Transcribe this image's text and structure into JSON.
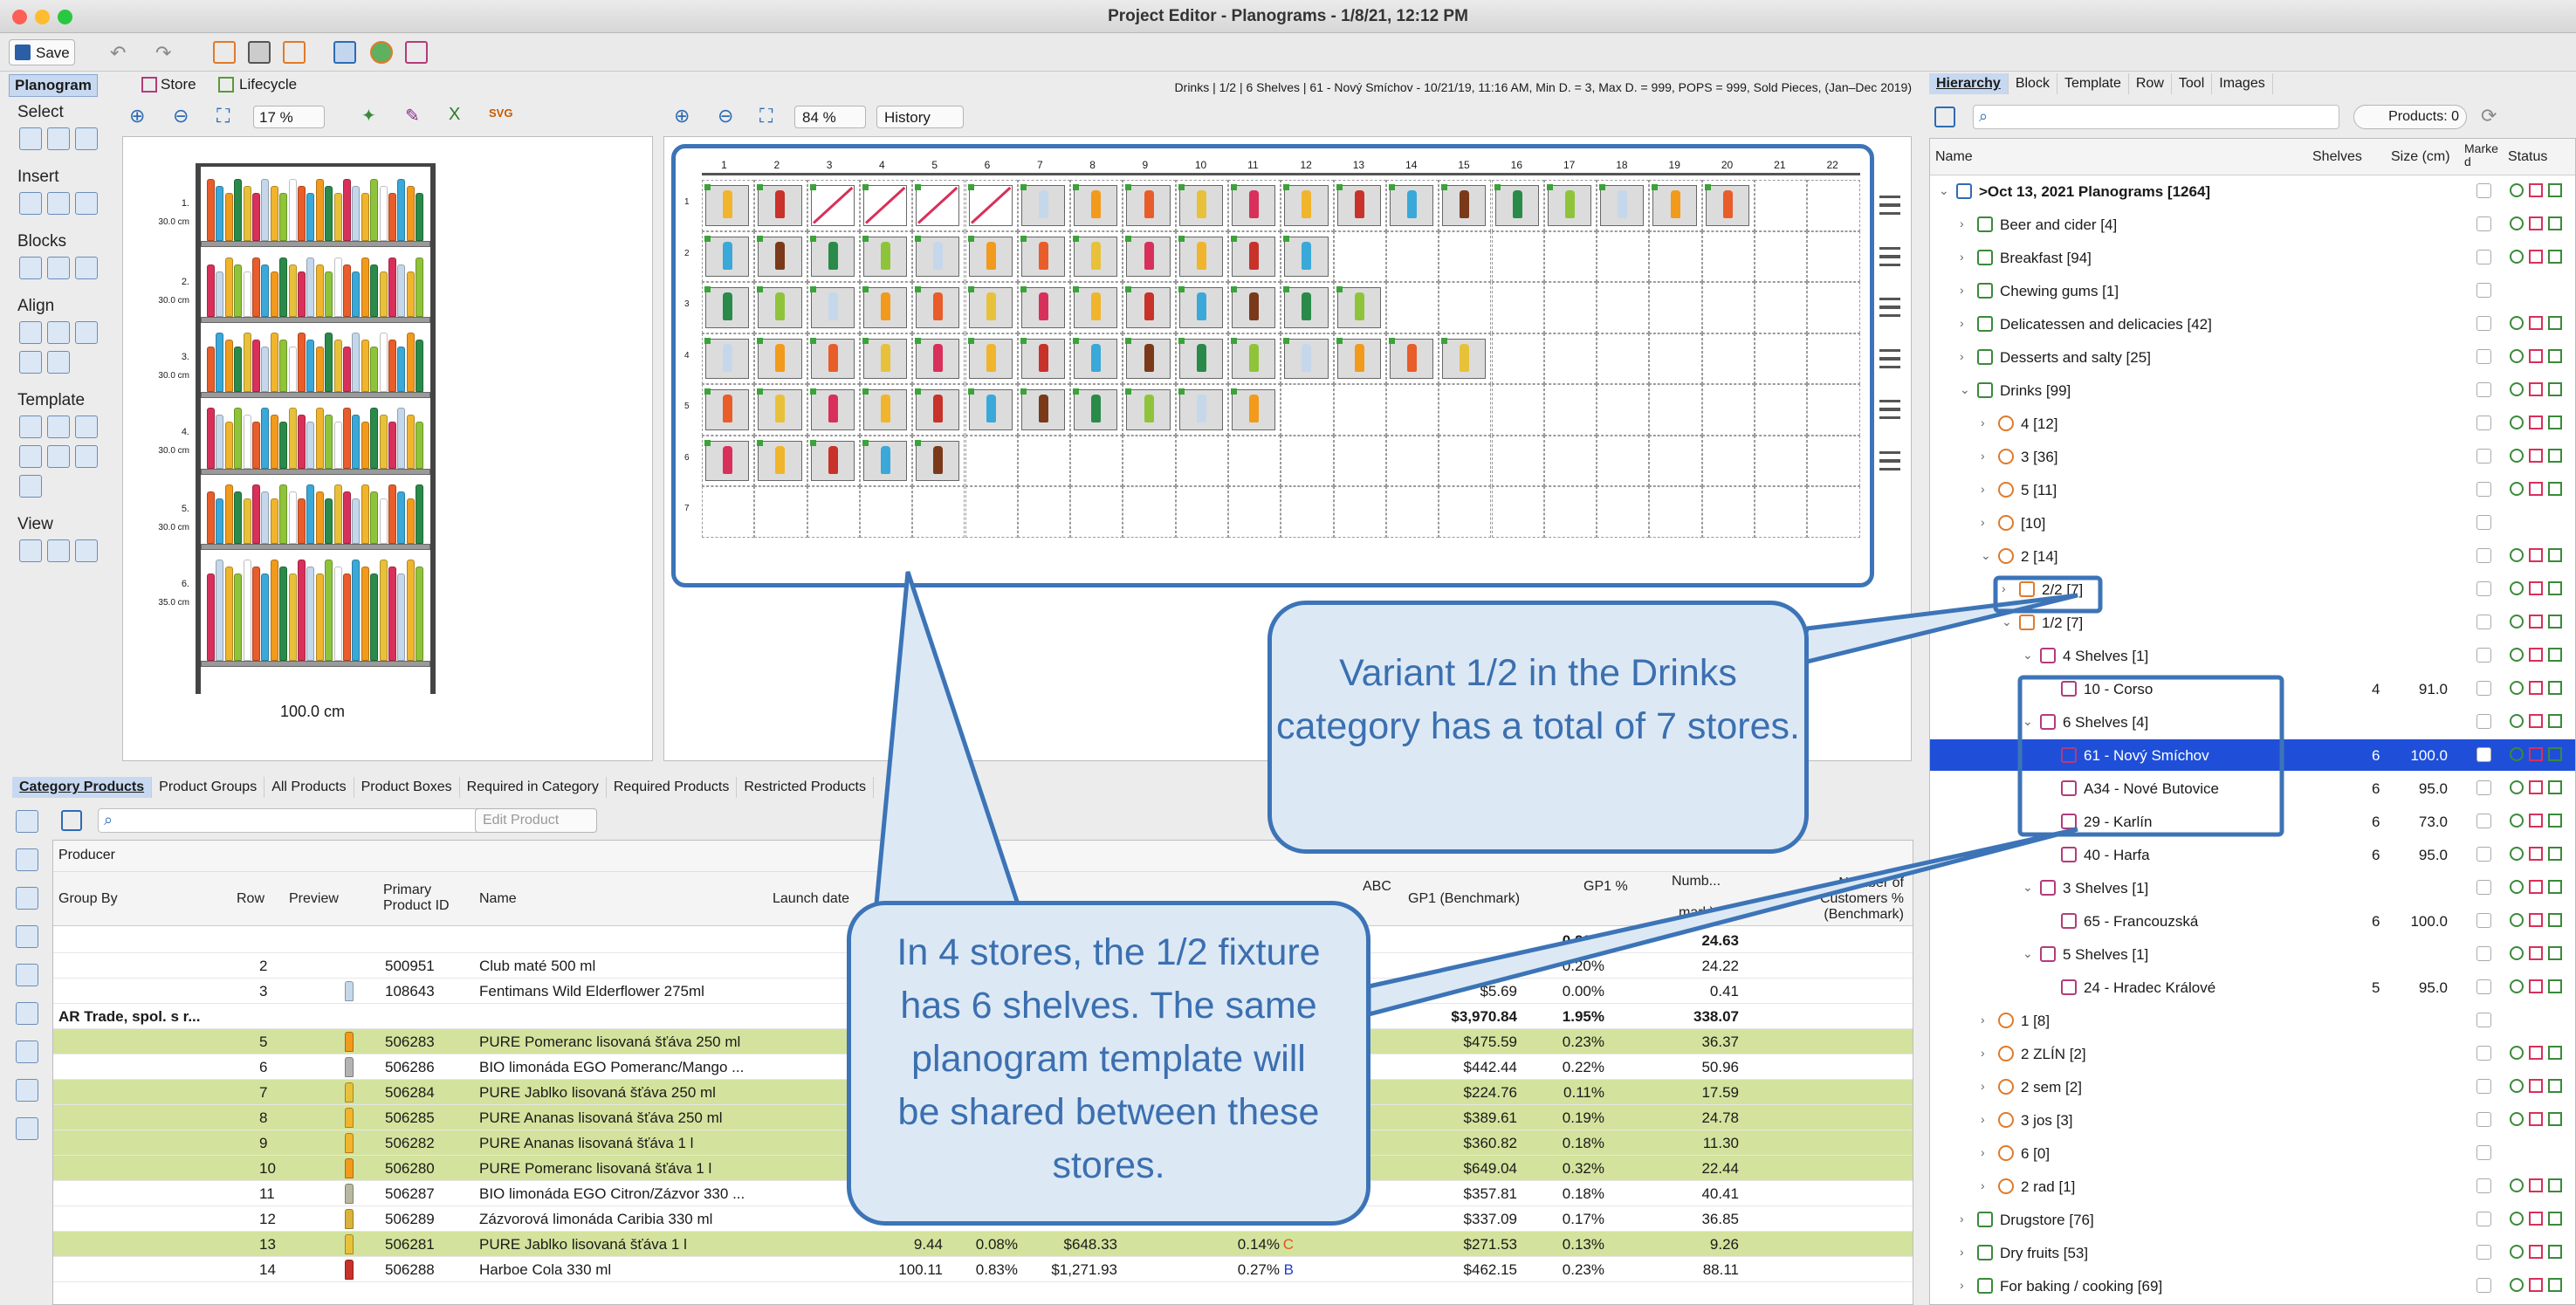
{
  "window": {
    "title": "Project Editor - Planograms - 1/8/21, 12:12 PM"
  },
  "toolbar": {
    "save_label": "Save"
  },
  "mode_tabs": [
    {
      "label": "Planogram"
    },
    {
      "label": "Store"
    },
    {
      "label": "Lifecycle"
    }
  ],
  "info_line": "Drinks | 1/2 | 6 Shelves | 61 - Nový Smíchov - 10/21/19, 11:16 AM, Min D. = 3, Max D. = 999, POPS = 999, Sold Pieces, (Jan–Dec 2019)",
  "left_tools": {
    "groups": [
      "Select",
      "Insert",
      "Blocks",
      "Align",
      "Template",
      "View"
    ],
    "zoom": "17 %"
  },
  "mini_planogram": {
    "shelves": [
      {
        "num": "1.",
        "height": "30.0 cm"
      },
      {
        "num": "2.",
        "height": "30.0 cm"
      },
      {
        "num": "3.",
        "height": "30.0 cm"
      },
      {
        "num": "4.",
        "height": "30.0 cm"
      },
      {
        "num": "5.",
        "height": "30.0 cm"
      },
      {
        "num": "6.",
        "height": "35.0 cm"
      }
    ],
    "width_label": "100.0 cm"
  },
  "grid_view": {
    "zoom": "84 %",
    "history_label": "History",
    "columns": [
      "1",
      "2",
      "3",
      "4",
      "5",
      "6",
      "7",
      "8",
      "9",
      "10",
      "11",
      "12",
      "13",
      "14",
      "15",
      "16",
      "17",
      "18",
      "19",
      "20",
      "21",
      "22"
    ],
    "row_labels": [
      "1",
      "2",
      "3",
      "4",
      "5",
      "6",
      "7"
    ],
    "row_counts": [
      20,
      12,
      13,
      15,
      11,
      5,
      0
    ]
  },
  "right_tabs": [
    "Hierarchy",
    "Block",
    "Template",
    "Row",
    "Tool",
    "Images"
  ],
  "products_count": "Products: 0",
  "tree_headers": {
    "name": "Name",
    "shelves": "Shelves",
    "size": "Size (cm)",
    "marked": "Marked",
    "status": "Status"
  },
  "tree": [
    {
      "indent": 0,
      "exp": "v",
      "label": ">Oct 13, 2021 Planograms [1264]",
      "bold": true,
      "icon": "doc-icon",
      "status": true
    },
    {
      "indent": 1,
      "exp": ">",
      "label": "Beer and cider [4]",
      "icon": "category-icon",
      "status": true
    },
    {
      "indent": 1,
      "exp": ">",
      "label": "Breakfast [94]",
      "icon": "category-icon",
      "status": true
    },
    {
      "indent": 1,
      "exp": ">",
      "label": "Chewing gums [1]",
      "icon": "category-icon",
      "status": false
    },
    {
      "indent": 1,
      "exp": ">",
      "label": "Delicatessen and delicacies [42]",
      "icon": "category-icon",
      "status": true
    },
    {
      "indent": 1,
      "exp": ">",
      "label": "Desserts and salty [25]",
      "icon": "category-icon",
      "status": true
    },
    {
      "indent": 1,
      "exp": "v",
      "label": "Drinks [99]",
      "icon": "category-icon",
      "status": true
    },
    {
      "indent": 2,
      "exp": ">",
      "label": "4 [12]",
      "icon": "cluster-icon",
      "status": true
    },
    {
      "indent": 2,
      "exp": ">",
      "label": "3 [36]",
      "icon": "cluster-icon",
      "status": true
    },
    {
      "indent": 2,
      "exp": ">",
      "label": "5 [11]",
      "icon": "cluster-icon",
      "status": true
    },
    {
      "indent": 2,
      "exp": ">",
      "label": "[10]",
      "icon": "cluster-icon",
      "status": false
    },
    {
      "indent": 2,
      "exp": "v",
      "label": "2 [14]",
      "icon": "cluster-icon",
      "status": true
    },
    {
      "indent": 3,
      "exp": ">",
      "label": "2/2 [7]",
      "icon": "fixture-icon",
      "status": true
    },
    {
      "indent": 3,
      "exp": "v",
      "label": "1/2 [7]",
      "icon": "fixture-icon",
      "status": true
    },
    {
      "indent": 4,
      "exp": "v",
      "label": "4 Shelves [1]",
      "icon": "store-icon",
      "status": true
    },
    {
      "indent": 5,
      "exp": "",
      "label": "10 - Corso",
      "icon": "store-icon",
      "shelves": "4",
      "size": "91.0",
      "status": true
    },
    {
      "indent": 4,
      "exp": "v",
      "label": "6 Shelves [4]",
      "icon": "store-icon",
      "status": true
    },
    {
      "indent": 5,
      "exp": "",
      "label": "61 - Nový Smíchov",
      "icon": "store-icon",
      "shelves": "6",
      "size": "100.0",
      "status": true,
      "selected": true
    },
    {
      "indent": 5,
      "exp": "",
      "label": "A34 - Nové Butovice",
      "icon": "store-icon",
      "shelves": "6",
      "size": "95.0",
      "status": true
    },
    {
      "indent": 5,
      "exp": "",
      "label": "29 - Karlín",
      "icon": "store-icon",
      "shelves": "6",
      "size": "73.0",
      "status": true
    },
    {
      "indent": 5,
      "exp": "",
      "label": "40 - Harfa",
      "icon": "store-icon",
      "shelves": "6",
      "size": "95.0",
      "status": true
    },
    {
      "indent": 4,
      "exp": "v",
      "label": "3 Shelves [1]",
      "icon": "store-icon",
      "status": true
    },
    {
      "indent": 5,
      "exp": "",
      "label": "65 - Francouzská",
      "icon": "store-icon",
      "shelves": "6",
      "size": "100.0",
      "status": true
    },
    {
      "indent": 4,
      "exp": "v",
      "label": "5 Shelves [1]",
      "icon": "store-icon",
      "status": true
    },
    {
      "indent": 5,
      "exp": "",
      "label": "24 - Hradec Králové",
      "icon": "store-icon",
      "shelves": "5",
      "size": "95.0",
      "status": true
    },
    {
      "indent": 2,
      "exp": ">",
      "label": "1 [8]",
      "icon": "cluster-icon",
      "status": false
    },
    {
      "indent": 2,
      "exp": ">",
      "label": "2 ZLÍN [2]",
      "icon": "cluster-icon",
      "status": true
    },
    {
      "indent": 2,
      "exp": ">",
      "label": "2 sem [2]",
      "icon": "cluster-icon",
      "status": true
    },
    {
      "indent": 2,
      "exp": ">",
      "label": "3 jos [3]",
      "icon": "cluster-icon",
      "status": true
    },
    {
      "indent": 2,
      "exp": ">",
      "label": "6 [0]",
      "icon": "cluster-icon",
      "status": false
    },
    {
      "indent": 2,
      "exp": ">",
      "label": "2 rad [1]",
      "icon": "cluster-icon",
      "status": true
    },
    {
      "indent": 1,
      "exp": ">",
      "label": "Drugstore [76]",
      "icon": "category-icon",
      "status": true
    },
    {
      "indent": 1,
      "exp": ">",
      "label": "Dry fruits [53]",
      "icon": "category-icon",
      "status": true
    },
    {
      "indent": 1,
      "exp": ">",
      "label": "For baking / cooking [69]",
      "icon": "category-icon",
      "status": true
    },
    {
      "indent": 1,
      "exp": ">",
      "label": "Freezer [16]",
      "icon": "category-icon",
      "status": true
    },
    {
      "indent": 1,
      "exp": ">",
      "label": "Freezer Richard [2]",
      "icon": "category-icon",
      "status": true
    }
  ],
  "bottom_tabs": [
    "Category Products",
    "Product Groups",
    "All Products",
    "Product Boxes",
    "Required in Category",
    "Required Products",
    "Restricted Products"
  ],
  "edit_product_label": "Edit Product",
  "group_chip": "Producer",
  "table_headers": {
    "group_by": "Group By",
    "row": "Row",
    "preview": "Preview",
    "primary_id": "Primary Product ID",
    "name": "Name",
    "launch": "Launch date",
    "abc": "ABC",
    "gp1": "GP1 (Benchmark)",
    "gp1pct": "GP1 %",
    "num": "Numb...",
    "mark": "mark)",
    "cust": "Number of Customers % (Benchmark)"
  },
  "table_rows": [
    {
      "group": "",
      "row": "",
      "id": "",
      "name": "",
      "gp1": "",
      "gp1pct": "0.20%",
      "num": "24.63",
      "last": "0",
      "bold": true,
      "green": false,
      "bottle": ""
    },
    {
      "group": "",
      "row": "2",
      "id": "500951",
      "name": "Club maté 500 ml",
      "gp1": "",
      "gp1pct": "0.20%",
      "num": "24.22",
      "last": "0",
      "green": false,
      "bottle": ""
    },
    {
      "group": "",
      "row": "3",
      "id": "108643",
      "name": "Fentimans Wild Elderflower 275ml",
      "gp1": "$5.69",
      "gp1pct": "0.00%",
      "num": "0.41",
      "last": "0",
      "green": false,
      "bottle": "#c5d7ea"
    },
    {
      "group": "AR Trade, spol. s r...",
      "row": "",
      "id": "",
      "name": "",
      "gp1": "$3,970.84",
      "gp1pct": "1.95%",
      "num": "338.07",
      "last": "2",
      "bold": true,
      "green": false,
      "bottle": ""
    },
    {
      "group": "",
      "row": "5",
      "id": "506283",
      "name": "PURE Pomeranc lisovaná šťáva 250 ml",
      "gp1": "$475.59",
      "gp1pct": "0.23%",
      "num": "36.37",
      "last": "0",
      "green": true,
      "bottle": "#f29a1c"
    },
    {
      "group": "",
      "row": "6",
      "id": "506286",
      "name": "BIO limonáda EGO Pomeranc/Mango ...",
      "gp1": "$442.44",
      "gp1pct": "0.22%",
      "num": "50.96",
      "last": "0",
      "green": false,
      "bottle": "#b3b3b3"
    },
    {
      "group": "",
      "row": "7",
      "id": "506284",
      "name": "PURE Jablko lisovaná šťáva 250 ml",
      "gp1": "$224.76",
      "gp1pct": "0.11%",
      "num": "17.59",
      "last": "0",
      "green": true,
      "bottle": "#e8c13a"
    },
    {
      "group": "",
      "row": "8",
      "id": "506285",
      "name": "PURE Ananas lisovaná šťáva 250 ml",
      "gp1": "$389.61",
      "gp1pct": "0.19%",
      "num": "24.78",
      "last": "0",
      "green": true,
      "bottle": "#f0b52c"
    },
    {
      "group": "",
      "row": "9",
      "id": "506282",
      "name": "PURE Ananas lisovaná šťáva 1 l",
      "gp1": "$360.82",
      "gp1pct": "0.18%",
      "num": "11.30",
      "last": "0",
      "green": true,
      "bottle": "#f0b52c"
    },
    {
      "group": "",
      "row": "10",
      "id": "506280",
      "name": "PURE Pomeranc lisovaná šťáva 1 l",
      "gp1": "$649.04",
      "gp1pct": "0.32%",
      "num": "22.44",
      "last": "0",
      "green": true,
      "bottle": "#f29a1c"
    },
    {
      "group": "",
      "row": "11",
      "id": "506287",
      "name": "BIO limonáda EGO Citron/Zázvor 330 ...",
      "gp1": "$357.81",
      "gp1pct": "0.18%",
      "num": "40.41",
      "last": "0",
      "green": false,
      "bottle": "#b8b8a0"
    },
    {
      "group": "",
      "row": "12",
      "id": "506289",
      "name": "Zázvorová limonáda Caribia 330 ml",
      "gp1": "$337.09",
      "gp1pct": "0.17%",
      "num": "36.85",
      "last": "0",
      "green": false,
      "bottle": "#d9b33a"
    },
    {
      "group": "",
      "row": "13",
      "id": "506281",
      "name": "PURE Jablko lisovaná šťáva 1 l",
      "c1": "9.44",
      "c2": "0.08%",
      "c3": "$648.33",
      "c4": "0.14%",
      "abc": "C",
      "abc_color": "#e0561c",
      "gp1": "$271.53",
      "gp1pct": "0.13%",
      "num": "9.26",
      "last": "0",
      "green": true,
      "bottle": "#e8c13a"
    },
    {
      "group": "",
      "row": "14",
      "id": "506288",
      "name": "Harboe Cola 330 ml",
      "c1": "100.11",
      "c2": "0.83%",
      "c3": "$1,271.93",
      "c4": "0.27%",
      "abc": "B",
      "abc_color": "#1f3fc8",
      "gp1": "$462.15",
      "gp1pct": "0.23%",
      "num": "88.11",
      "last": "0",
      "green": false,
      "bottle": "#c8322a"
    }
  ],
  "callouts": {
    "variant": "Variant 1/2 in the Drinks category has a total of 7 stores.",
    "fixture": "In 4 stores, the 1/2 fixture has 6 shelves. The same planogram template will be shared between these stores."
  },
  "colors": {
    "accent": "#3c74b7",
    "selection": "#1f4fd8",
    "callout_fill": "#dce9f5",
    "row_highlight": "#d3e39d"
  }
}
